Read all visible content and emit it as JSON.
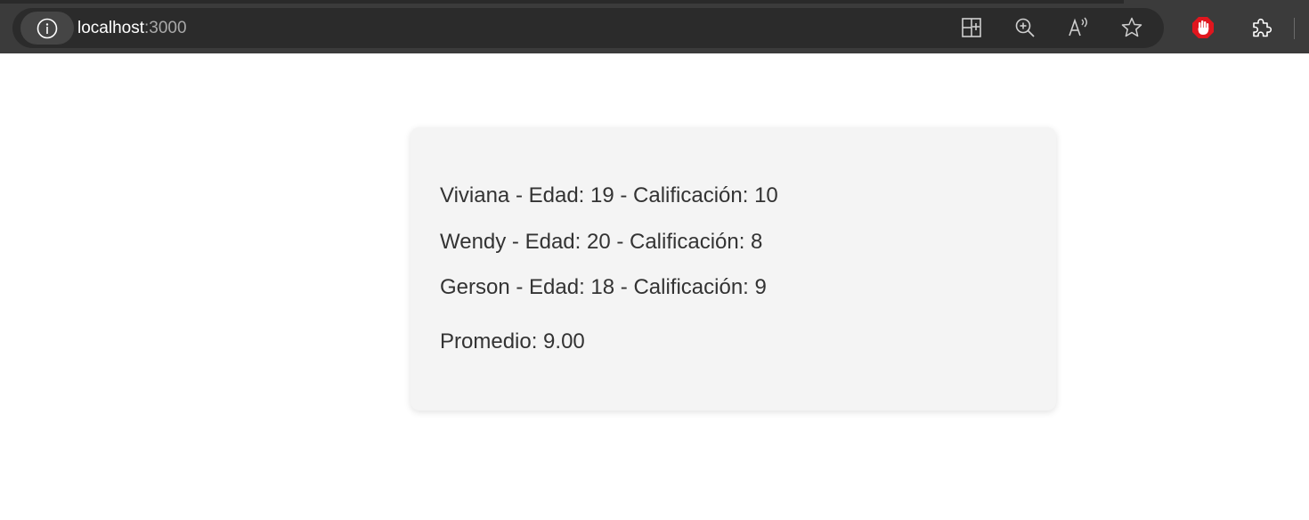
{
  "browser": {
    "address": {
      "host": "localhost",
      "port": ":3000"
    },
    "icons": [
      "info-icon",
      "split-screen-icon",
      "zoom-icon",
      "read-aloud-icon",
      "favorite-star-icon",
      "adblock-icon",
      "extensions-icon"
    ]
  },
  "students": [
    {
      "text": "Viviana - Edad: 19 - Calificación: 10"
    },
    {
      "text": "Wendy - Edad: 20 - Calificación: 8"
    },
    {
      "text": "Gerson - Edad: 18 - Calificación: 9"
    }
  ],
  "average": {
    "text": "Promedio: 9.00"
  },
  "colors": {
    "toolbar": "#3b3b3b",
    "address_bar": "#2b2b2b",
    "card_background": "#f4f4f4",
    "text": "#333333",
    "adblock_red": "#e0161e"
  }
}
